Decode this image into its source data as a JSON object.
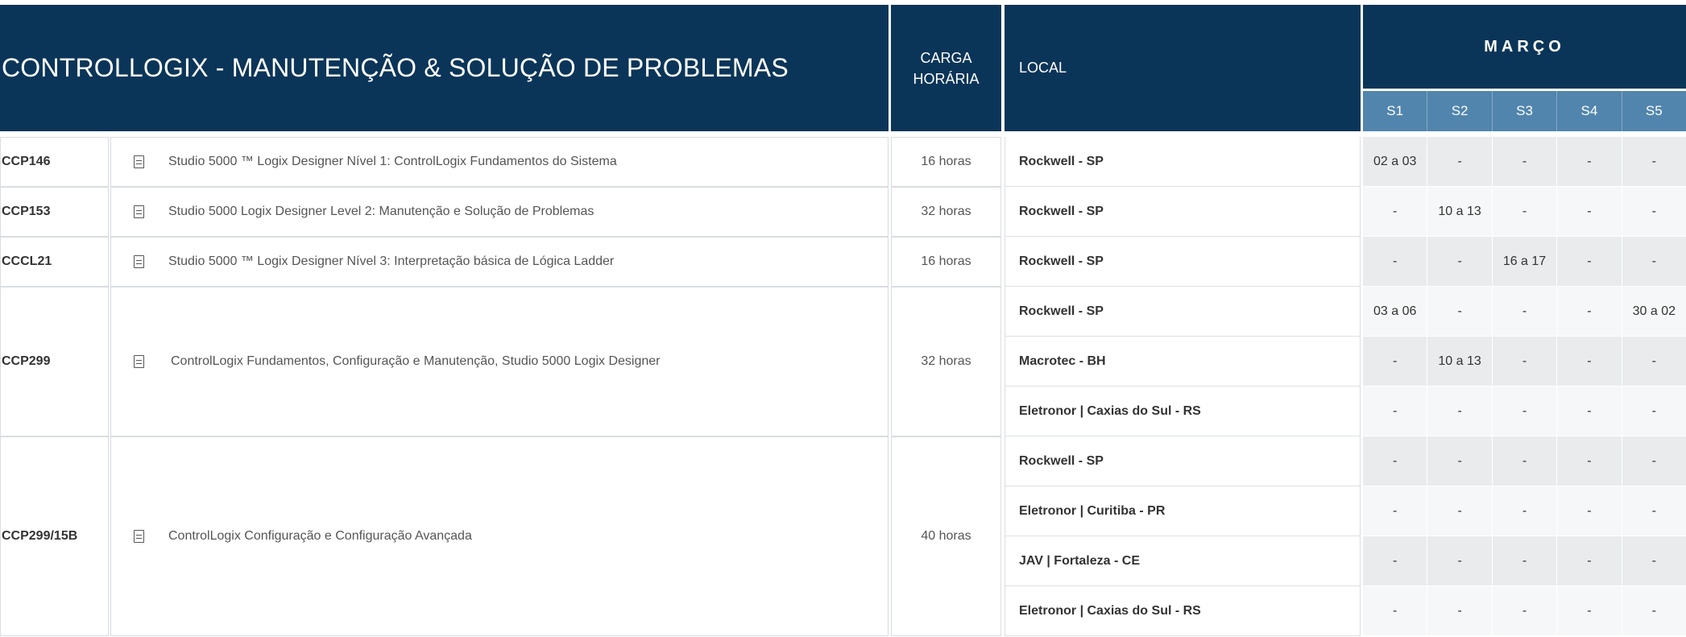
{
  "header": {
    "title": "CONTROLLOGIX - MANUTENÇÃO & SOLUÇÃO DE PROBLEMAS",
    "carga_line1": "CARGA",
    "carga_line2": "HORÁRIA",
    "local": "LOCAL",
    "month": "MARÇO",
    "weeks": [
      "S1",
      "S2",
      "S3",
      "S4",
      "S5"
    ]
  },
  "courses": [
    {
      "code": "CCP146",
      "name": "Studio 5000 ™ Logix Designer Nível 1: ControlLogix Fundamentos do Sistema",
      "hours": "16 horas"
    },
    {
      "code": "CCP153",
      "name": "Studio 5000 Logix Designer Level 2: Manutenção e Solução de Problemas",
      "hours": "32 horas"
    },
    {
      "code": "CCCL21",
      "name": "Studio 5000 ™ Logix Designer Nível 3: Interpretação básica de Lógica Ladder",
      "hours": "16 horas"
    },
    {
      "code": "CCP299",
      "name": "ControlLogix Fundamentos, Configuração e Manutenção, Studio 5000 Logix Designer",
      "hours": "32 horas"
    },
    {
      "code": "CCP299/15B",
      "name": "ControlLogix Configuração e Configuração Avançada",
      "hours": "40 horas"
    }
  ],
  "sessions": [
    {
      "local": "Rockwell - SP",
      "weeks": [
        "02 a 03",
        "-",
        "-",
        "-",
        "-"
      ]
    },
    {
      "local": "Rockwell - SP",
      "weeks": [
        "-",
        "10 a 13",
        "-",
        "-",
        "-"
      ]
    },
    {
      "local": "Rockwell - SP",
      "weeks": [
        "-",
        "-",
        "16 a 17",
        "-",
        "-"
      ]
    },
    {
      "local": "Rockwell - SP",
      "weeks": [
        "03 a 06",
        "-",
        "-",
        "-",
        "30 a 02"
      ]
    },
    {
      "local": "Macrotec - BH",
      "weeks": [
        "-",
        "10 a 13",
        "-",
        "-",
        "-"
      ]
    },
    {
      "local": "Eletronor | Caxias do Sul - RS",
      "weeks": [
        "-",
        "-",
        "-",
        "-",
        "-"
      ]
    },
    {
      "local": "Rockwell - SP",
      "weeks": [
        "-",
        "-",
        "-",
        "-",
        "-"
      ]
    },
    {
      "local": "Eletronor | Curitiba - PR",
      "weeks": [
        "-",
        "-",
        "-",
        "-",
        "-"
      ]
    },
    {
      "local": "JAV | Fortaleza - CE",
      "weeks": [
        "-",
        "-",
        "-",
        "-",
        "-"
      ]
    },
    {
      "local": "Eletronor | Caxias do Sul - RS",
      "weeks": [
        "-",
        "-",
        "-",
        "-",
        "-"
      ]
    }
  ],
  "icon": "document-icon",
  "colors": {
    "header_bg": "#0b3558",
    "week_header_bg": "#5185ad",
    "alt_row_bg": "#e9ebed"
  }
}
